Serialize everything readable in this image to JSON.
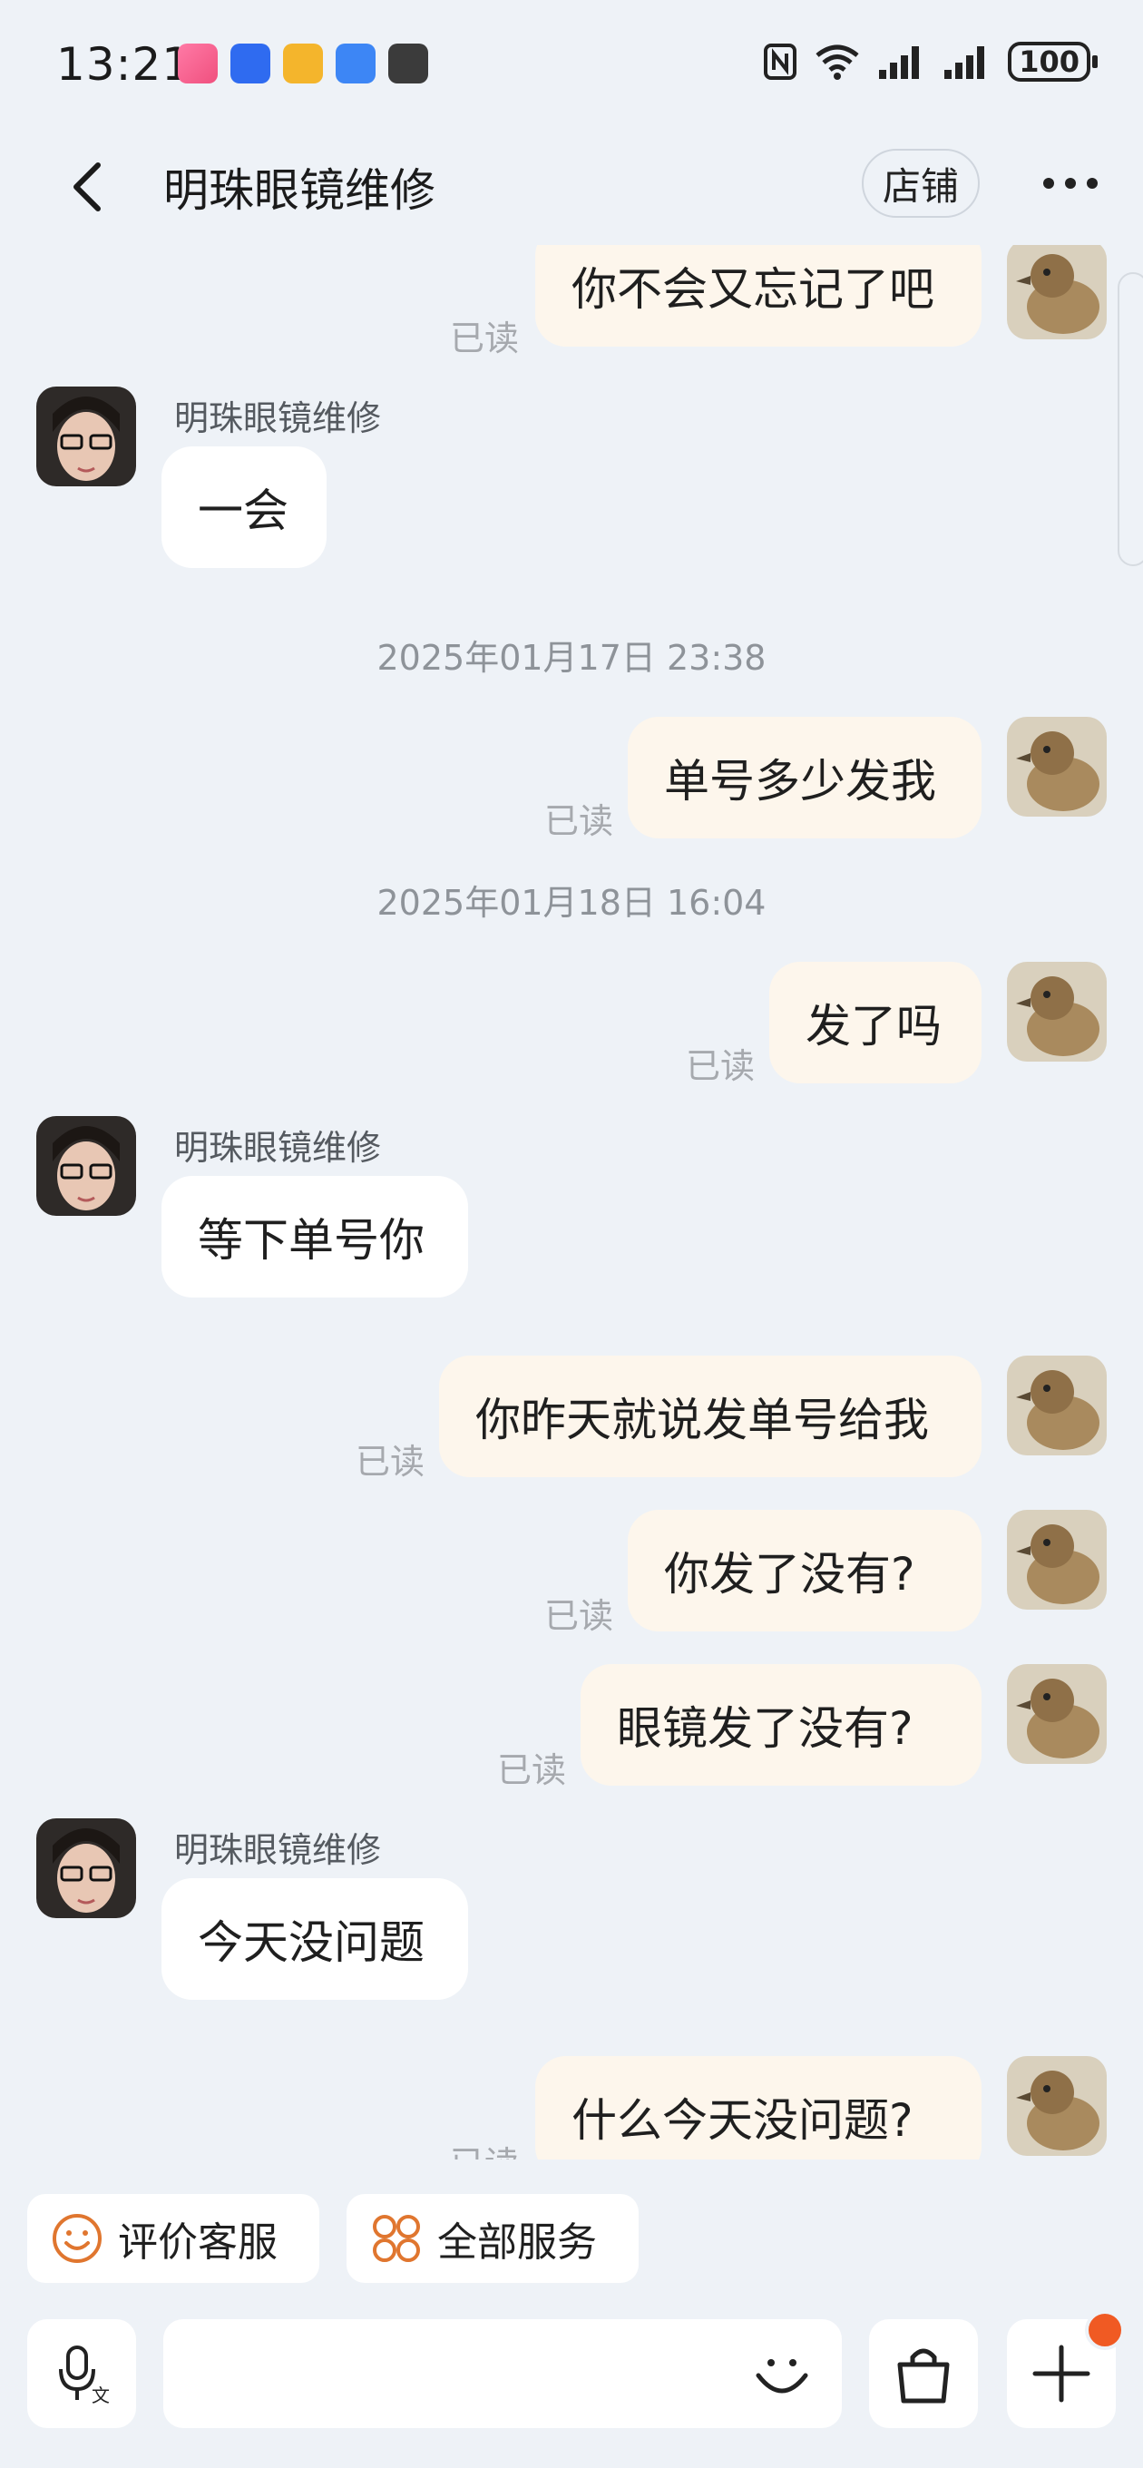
{
  "status_bar": {
    "time": "13:21",
    "battery": "100"
  },
  "header": {
    "title": "明珠眼镜维修",
    "shop_label": "店铺"
  },
  "chat": {
    "messages": [
      {
        "dir": "out",
        "text": "你不会又忘记了吧",
        "read": "已读"
      },
      {
        "dir": "in",
        "sender": "明珠眼镜维修",
        "text": "一会"
      },
      {
        "type": "time",
        "text": "2025年01月17日 23:38"
      },
      {
        "dir": "out",
        "text": "单号多少发我",
        "read": "已读"
      },
      {
        "type": "time",
        "text": "2025年01月18日 16:04"
      },
      {
        "dir": "out",
        "text": "发了吗",
        "read": "已读"
      },
      {
        "dir": "in",
        "sender": "明珠眼镜维修",
        "text": "等下单号你"
      },
      {
        "dir": "out",
        "text": "你昨天就说发单号给我",
        "read": "已读"
      },
      {
        "dir": "out",
        "text": "你发了没有?",
        "read": "已读"
      },
      {
        "dir": "out",
        "text": "眼镜发了没有?",
        "read": "已读"
      },
      {
        "dir": "in",
        "sender": "明珠眼镜维修",
        "text": "今天没问题"
      },
      {
        "dir": "out",
        "text": "什么今天没问题?",
        "read": "已读"
      }
    ]
  },
  "quick_actions": [
    {
      "label": "评价客服",
      "icon": "smile-icon"
    },
    {
      "label": "全部服务",
      "icon": "grid-icon"
    }
  ],
  "input_bar": {
    "voice_icon": "voice-input-icon",
    "emoji_icon": "emoji-icon",
    "bag_icon": "shopping-bag-icon",
    "plus_icon": "plus-icon"
  }
}
